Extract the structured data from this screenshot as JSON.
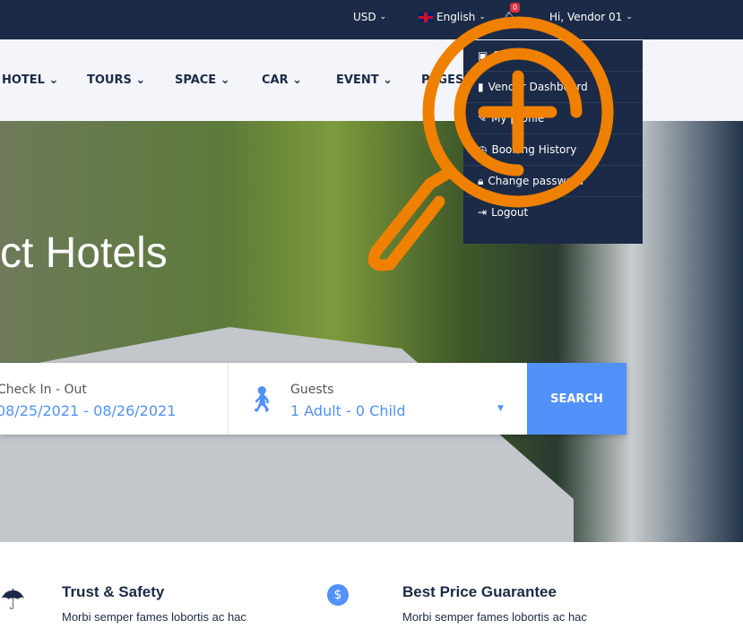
{
  "topbar": {
    "currency": "USD",
    "language": "English",
    "notifications": "0",
    "user": "Hi, Vendor 01"
  },
  "nav": [
    "HOTEL",
    "TOURS",
    "SPACE",
    "CAR",
    "EVENT",
    "PAGES"
  ],
  "hero": {
    "title": "ct Hotels"
  },
  "search": {
    "date_label": "Check In - Out",
    "date_value": "08/25/2021 - 08/26/2021",
    "guests_label": "Guests",
    "guests_value": "1 Adult - 0 Child",
    "button": "SEARCH"
  },
  "user_menu": [
    "Credit: 0",
    "Vendor Dashboard",
    "My profile",
    "Booking History",
    "Change password",
    "Logout"
  ],
  "features": [
    {
      "title": "Trust & Safety",
      "text": "Morbi semper fames lobortis ac hac"
    },
    {
      "title": "Best Price Guarantee",
      "text": "Morbi semper fames lobortis ac hac"
    }
  ],
  "colors": {
    "topbar": "#1b2a47",
    "accent": "#5191fa",
    "overlay": "#f08000"
  }
}
